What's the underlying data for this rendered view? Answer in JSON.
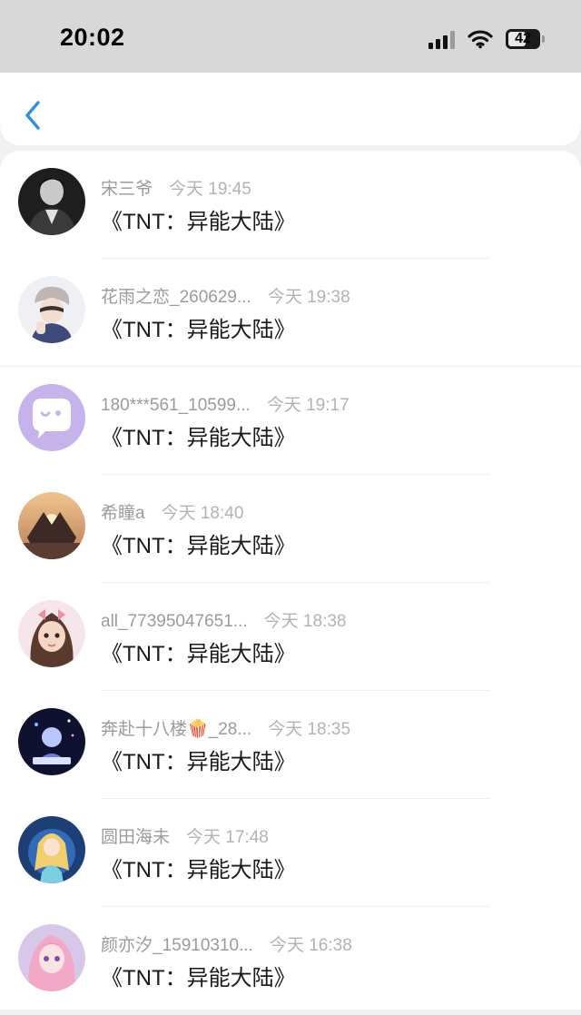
{
  "status_bar": {
    "time": "20:02",
    "battery": "42"
  },
  "nav": {
    "back_icon": "chevron-left-icon",
    "accent": "#2f8fe0"
  },
  "rows": [
    {
      "name": "宋三爷",
      "time": "今天 19:45",
      "title": "《TNT：异能大陆》"
    },
    {
      "name": "花雨之恋_260629...",
      "time": "今天 19:38",
      "title": "《TNT：异能大陆》"
    },
    {
      "name": "180***561_10599...",
      "time": "今天 19:17",
      "title": "《TNT：异能大陆》"
    },
    {
      "name": "希瞳a",
      "time": "今天 18:40",
      "title": "《TNT：异能大陆》"
    },
    {
      "name": "all_77395047651...",
      "time": "今天 18:38",
      "title": "《TNT：异能大陆》"
    },
    {
      "name": "奔赴十八楼🍿_28...",
      "time": "今天 18:35",
      "title": "《TNT：异能大陆》"
    },
    {
      "name": "圆田海未",
      "time": "今天 17:48",
      "title": "《TNT：异能大陆》"
    },
    {
      "name": "颜亦汐_15910310...",
      "time": "今天 16:38",
      "title": "《TNT：异能大陆》"
    }
  ]
}
